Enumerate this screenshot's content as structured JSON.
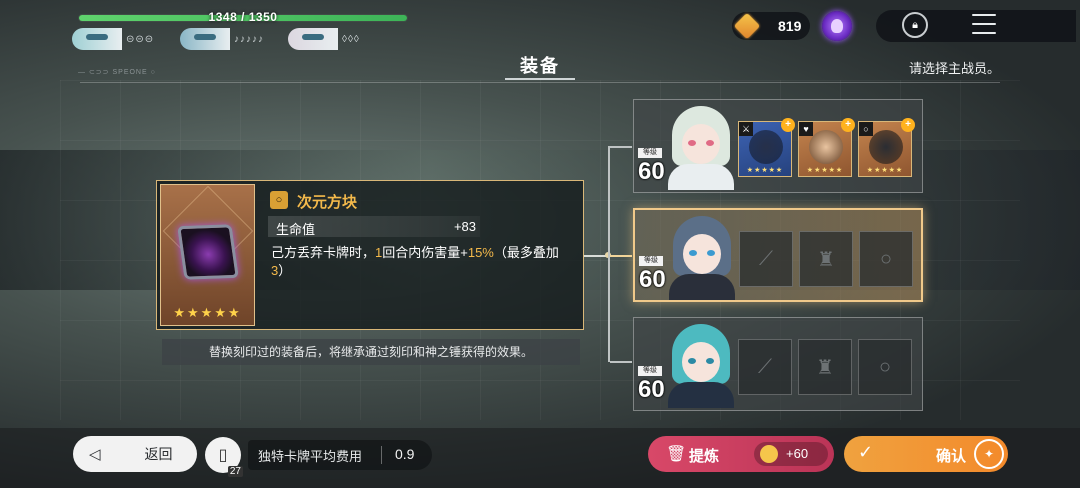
{
  "party": {
    "hp_text": "1348 / 1350",
    "hp_fraction": 0.9985,
    "members": [
      {
        "pips": "⊝⊝⊝",
        "hair": "#9fd0d4",
        "eye": "#4fa0b0"
      },
      {
        "pips": "♪♪♪♪♪",
        "hair": "#8ab6c6",
        "eye": "#3a72a0"
      },
      {
        "pips": "◊◊◊",
        "hair": "#dcd7e0",
        "eye": "#d34e63"
      }
    ],
    "tiny_label": "— ⊂⊃⊃ SPEONE ○"
  },
  "currency": {
    "value": "819",
    "icon": "gem-icon"
  },
  "header": {
    "title": "装备",
    "hint": "请选择主战员。"
  },
  "equipment": {
    "name": "次元方块",
    "slot_icon": "ring-icon",
    "slot_glyph": "○",
    "stat_label": "生命值",
    "stat_value": "+83",
    "desc_parts": [
      "己方丢弃卡牌时，",
      "1",
      "回合内伤害量+",
      "15%",
      "（最多叠加",
      "3",
      "）"
    ],
    "stars": "★★★★★",
    "note": "替换刻印过的装备后，将继承通过刻印和神之锤获得的效果。"
  },
  "characters": [
    {
      "level_tag": "等级",
      "level": "60",
      "selected": false,
      "hair": "#dde8df",
      "eye": "#e06a85",
      "body": "#e9eef0",
      "slots": [
        {
          "type": "filled-blue",
          "corner": "⚔",
          "badge": "+",
          "stars": "★★★★★",
          "art": "#263049",
          "icon": "weapon-icon"
        },
        {
          "type": "filled-orange",
          "corner": "♥",
          "badge": "+",
          "stars": "★★★★★",
          "art": "#e9c4a0",
          "icon": "armor-icon"
        },
        {
          "type": "filled-orange",
          "corner": "○",
          "badge": "+",
          "stars": "★★★★★",
          "art": "#2a2d33",
          "icon": "ring-icon"
        }
      ]
    },
    {
      "level_tag": "等级",
      "level": "60",
      "selected": true,
      "hair": "#5b6f88",
      "eye": "#3b9ad0",
      "body": "#2a2f3a",
      "slots": [
        {
          "type": "empty",
          "ghost": "⟋",
          "icon": "weapon-slot-icon"
        },
        {
          "type": "empty",
          "ghost": "♜",
          "icon": "armor-slot-icon"
        },
        {
          "type": "empty",
          "ghost": "○",
          "icon": "ring-slot-icon"
        }
      ]
    },
    {
      "level_tag": "等级",
      "level": "60",
      "selected": false,
      "hair": "#4dbac0",
      "eye": "#2b8aa5",
      "body": "#243042",
      "slots": [
        {
          "type": "empty",
          "ghost": "⟋",
          "icon": "weapon-slot-icon"
        },
        {
          "type": "empty",
          "ghost": "♜",
          "icon": "armor-slot-icon"
        },
        {
          "type": "empty",
          "ghost": "○",
          "icon": "ring-slot-icon"
        }
      ]
    }
  ],
  "footer": {
    "back_label": "返回",
    "card_count": "27",
    "cost_label": "独特卡牌平均费用",
    "cost_value": "0.9",
    "refine_label": "提炼",
    "refine_cost": "+60",
    "confirm_label": "确认"
  }
}
